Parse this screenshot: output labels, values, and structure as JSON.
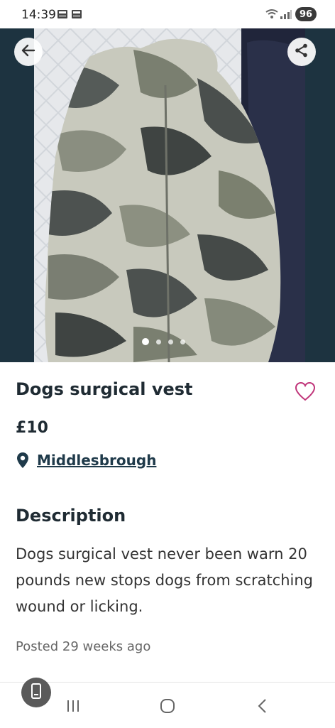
{
  "status_bar": {
    "time": "14:39",
    "battery": "96"
  },
  "gallery": {
    "image_count": 4,
    "active_index": 0,
    "back_icon": "arrow-left-icon",
    "share_icon": "share-icon"
  },
  "listing": {
    "title": "Dogs surgical vest",
    "price": "£10",
    "location": "Middlesbrough",
    "description_heading": "Description",
    "description": "Dogs surgical vest never been warn 20 pounds new stops dogs from scratching wound or licking.",
    "posted": "Posted 29 weeks ago"
  },
  "colors": {
    "header_bg": "#1d3340",
    "heart": "#c0357a",
    "location": "#1f3a4a"
  }
}
